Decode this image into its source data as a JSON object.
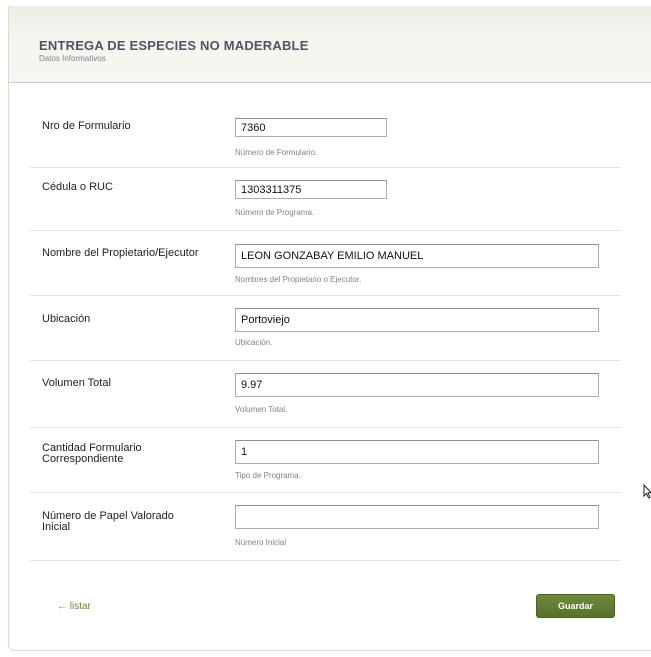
{
  "header": {
    "title": "ENTREGA DE ESPECIES NO MADERABLE",
    "subtitle": "Datos Informativos"
  },
  "fields": [
    {
      "label": "Nro de Formulario",
      "value": "7360",
      "help": "Número de Formulario."
    },
    {
      "label": "Cédula o RUC",
      "value": "1303311375",
      "help": "Número de Programa."
    },
    {
      "label": "Nombre del Propietario/Ejecutor",
      "value": "LEON GONZABAY EMILIO MANUEL",
      "help": "Nombres del Propietario o Ejecutor."
    },
    {
      "label": "Ubicación",
      "value": "Portoviejo",
      "help": "Ubicación."
    },
    {
      "label": "Volumen Total",
      "value": "9.97",
      "help": "Volumen Total."
    },
    {
      "label_line1": "Cantidad Formulario",
      "label_line2": "Correspondiente",
      "value": "1",
      "help": "Tipo de Programa."
    },
    {
      "label_line1": "Número de Papel Valorado",
      "label_line2": "Inicial",
      "value": "",
      "help": "Número Inicial"
    }
  ],
  "actions": {
    "back_label": "← listar",
    "save_label": "Guardar"
  },
  "colors": {
    "accent": "#5f7a31",
    "link": "#6d8a3c"
  },
  "icons": [
    "mouse-pointer-icon"
  ]
}
